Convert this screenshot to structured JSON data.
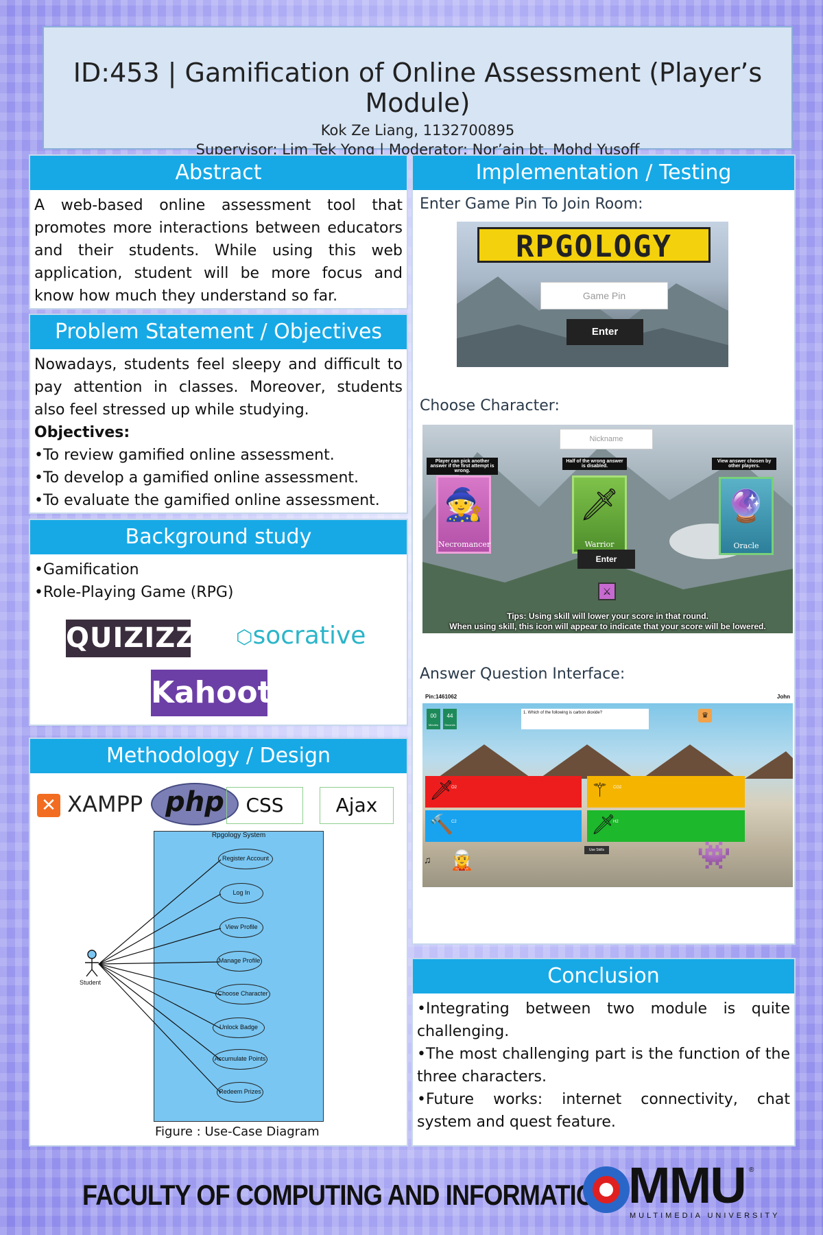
{
  "header": {
    "title": "ID:453 | Gamification of Online Assessment (Player’s Module)",
    "author": "Kok Ze Liang, 1132700895",
    "supervisor": "Supervisor: Lim Tek Yong | Moderator: Nor’ain bt. Mohd Yusoff"
  },
  "abstract": {
    "title": "Abstract",
    "text": "A web-based online assessment tool that promotes more interactions between educators and their students. While using this web application, student will be more focus and know how much they understand so far."
  },
  "problem": {
    "title": "Problem Statement / Objectives",
    "text": "Nowadays, students feel sleepy and difficult to pay attention in classes. Moreover, students also feel stressed up while studying.",
    "objectives_label": "Objectives:",
    "objectives": [
      "•To review gamified online assessment.",
      "•To develop a gamified online assessment.",
      "•To evaluate the gamified online assessment."
    ]
  },
  "background": {
    "title": "Background study",
    "items": [
      "•Gamification",
      "•Role-Playing Game (RPG)"
    ],
    "logos": {
      "quizizz": "QUIZIZZ",
      "socrative": "socrative",
      "kahoot": "Kahoot!"
    }
  },
  "methodology": {
    "title": "Methodology / Design",
    "tools": {
      "xampp": "XAMPP",
      "php": "php",
      "css": "CSS",
      "ajax": "Ajax"
    },
    "diagram": {
      "system": "Rpgology System",
      "actor": "Student",
      "use_cases": [
        "Register Account",
        "Log In",
        "View Profile",
        "Manage Profile",
        "Choose Character",
        "Unlock Badge",
        "Accumulate Points",
        "Redeem Prizes"
      ],
      "caption": "Figure : Use-Case Diagram"
    }
  },
  "implementation": {
    "title": "Implementation / Testing",
    "join_label": "Enter Game Pin To Join Room:",
    "logo": "RPGOLOGY",
    "game_pin_placeholder": "Game Pin",
    "enter": "Enter",
    "choose_label": "Choose Character:",
    "nickname_placeholder": "Nickname",
    "characters": [
      {
        "name": "Necromancer",
        "tip": "Player can pick another answer if the first attempt is wrong."
      },
      {
        "name": "Warrior",
        "tip": "Half of the wrong answer is disabled."
      },
      {
        "name": "Oracle",
        "tip": "View answer chosen by other players."
      }
    ],
    "tips_line1": "Tips: Using skill will lower your score in that round.",
    "tips_line2": "When using skill, this icon will appear to indicate that your score will be lowered.",
    "answer_label": "Answer Question Interface:",
    "pin": "Pin:1461062",
    "player": "John",
    "timer_min": "00",
    "timer_sec": "44",
    "timer_min_label": "Minutes",
    "timer_sec_label": "Seconds",
    "question": "1. Which of the following is carbon dioxide?",
    "answers": [
      "O2",
      "CO2",
      "C2",
      "H2"
    ],
    "use_skills": "Use Skills"
  },
  "conclusion": {
    "title": "Conclusion",
    "items": [
      "•Integrating between two module is quite challenging.",
      "•The most challenging part is the function of the three characters.",
      "•Future works: internet connectivity, chat system and quest feature."
    ]
  },
  "footer": {
    "faculty": "FACULTY OF COMPUTING AND INFORMATICS",
    "mmu": "MMU",
    "university": "MULTIMEDIA UNIVERSITY"
  },
  "colors": {
    "accent": "#17a9e6",
    "header_bg": "#d6e4f4",
    "background": "#a9a7f4"
  }
}
